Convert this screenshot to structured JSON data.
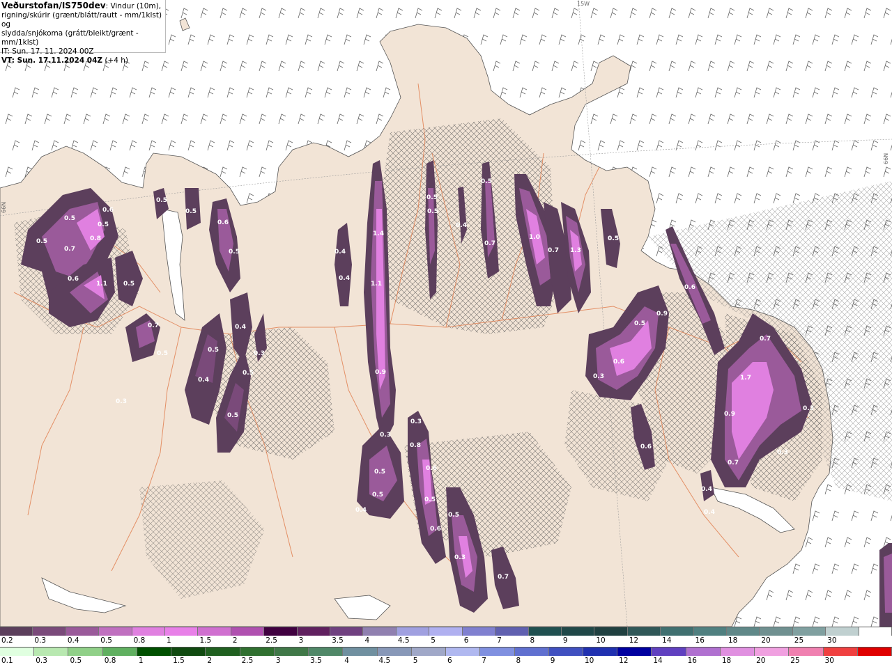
{
  "header": {
    "title": "Veðurstofan/IS750dev",
    "line1_rest": ": Vindur (10m),",
    "line2": "rigning/skúrir (grænt/blátt/rautt - mm/1klst) og",
    "line3": "slydda/snjókoma (grátt/bleikt/grænt - mm/1klst)",
    "init_time": "IT: Sun. 17. 11. 2024 00Z",
    "valid_label": "VT: Sun. 17.11.2024 04Z",
    "valid_offset": " (+4 h)"
  },
  "grid_labels": {
    "top": "15W",
    "left": "66N",
    "right": "66N"
  },
  "precip_labels": [
    "0.5",
    "0.6",
    "0.5",
    "0.8",
    "0.5",
    "0.7",
    "0.6",
    "1.1",
    "0.5",
    "0.7",
    "0.5",
    "0.5",
    "0.5",
    "0.6",
    "0.5",
    "0.4",
    "0.5",
    "0.3",
    "0.4",
    "0.5",
    "0.5",
    "0.3",
    "0.4",
    "0.4",
    "1.4",
    "1.1",
    "0.9",
    "0.3",
    "0.5",
    "0.5",
    "0.4",
    "0.5",
    "0.5",
    "0.4",
    "0.5",
    "0.7",
    "1.0",
    "0.7",
    "1.3",
    "0.5",
    "0.6",
    "0.4",
    "0.3",
    "0.8",
    "0.6",
    "0.5",
    "0.5",
    "0.6",
    "0.3",
    "0.7",
    "0.5",
    "0.9",
    "0.6",
    "0.3",
    "0.6",
    "0.7",
    "1.7",
    "0.9",
    "0.7",
    "0.3",
    "0.3",
    "0.4",
    "0.5"
  ],
  "legend_rain_snow": {
    "labels": [
      "0.2",
      "0.3",
      "0.4",
      "0.5",
      "0.8",
      "1",
      "1.5",
      "2",
      "2.5",
      "3",
      "3.5",
      "4",
      "4.5",
      "5",
      "6",
      "7",
      "8",
      "9",
      "10",
      "12",
      "14",
      "16",
      "18",
      "20",
      "25",
      "30"
    ],
    "colors": [
      "#5c3f5c",
      "#7a4a7a",
      "#9a5a9a",
      "#c070c0",
      "#e080e0",
      "#e880e8",
      "#d070d0",
      "#b050b0",
      "#400040",
      "#60205f",
      "#704080",
      "#9080b0",
      "#a0a0e0",
      "#b0b0f0",
      "#8080d0",
      "#6060b0",
      "#205050",
      "#204848",
      "#204040",
      "#305858",
      "#407070",
      "#508080",
      "#608888",
      "#709090",
      "#80a0a0",
      "#c0d0d0",
      "#ffffff"
    ]
  },
  "legend_rain": {
    "labels": [
      "0.1",
      "0.3",
      "0.5",
      "0.8",
      "1",
      "1.5",
      "2",
      "2.5",
      "3",
      "3.5",
      "4",
      "4.5",
      "5",
      "6",
      "7",
      "8",
      "9",
      "10",
      "12",
      "14",
      "16",
      "18",
      "20",
      "25",
      "30"
    ],
    "colors": [
      "#e0ffe0",
      "#b8e8b0",
      "#90d088",
      "#60b060",
      "#005000",
      "#104a10",
      "#206020",
      "#307030",
      "#407848",
      "#508868",
      "#7090a0",
      "#8898b8",
      "#a0a8c8",
      "#b0b8f0",
      "#8090e0",
      "#6070d0",
      "#4050c0",
      "#2030b0",
      "#0000a0",
      "#6040c0",
      "#b070d0",
      "#e090e0",
      "#f0a0e0",
      "#f080b0",
      "#f04040",
      "#e00000"
    ]
  }
}
